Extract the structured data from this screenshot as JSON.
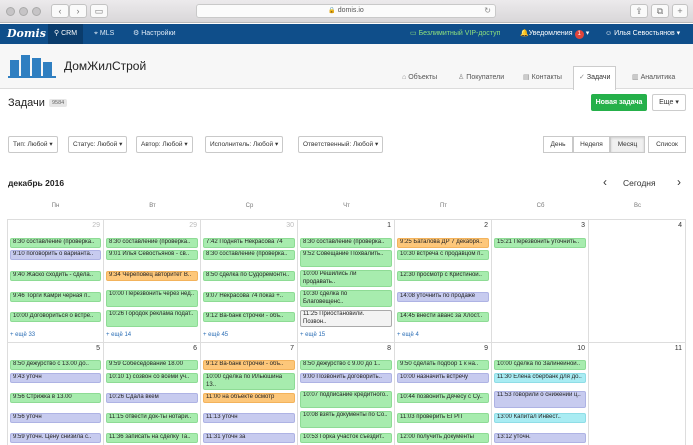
{
  "browser": {
    "url": "domis.io"
  },
  "topbar": {
    "logo": "Domis",
    "nav": [
      {
        "label": "CRM",
        "icon": "tree-icon"
      },
      {
        "label": "MLS",
        "icon": "pin-icon"
      },
      {
        "label": "Настройки",
        "icon": "gear-icon"
      }
    ],
    "vip": "Безлимитный VIP-доступ",
    "notifications_label": "Уведомления",
    "notifications_count": "1",
    "user": "Илья Севостьянов"
  },
  "company": {
    "name": "ДомЖилСтрой",
    "tabs": [
      {
        "label": "Объекты",
        "icon": "home-icon"
      },
      {
        "label": "Покупатели",
        "icon": "user-icon"
      },
      {
        "label": "Контакты",
        "icon": "contacts-icon"
      },
      {
        "label": "Задачи",
        "icon": "check-icon"
      },
      {
        "label": "Аналитика",
        "icon": "chart-icon"
      }
    ]
  },
  "page": {
    "title": "Задачи",
    "count": "9584",
    "new_task": "Новая задача",
    "more": "Еще"
  },
  "filters": [
    "Тип: Любой",
    "Статус: Любой",
    "Автор: Любой",
    "Исполнитель: Любой",
    "Ответственный: Любой"
  ],
  "views": [
    "День",
    "Неделя",
    "Месяц",
    "Список"
  ],
  "calendar": {
    "month": "декабрь 2016",
    "today": "Сегодня",
    "weekdays": [
      "Пн",
      "Вт",
      "Ср",
      "Чт",
      "Пт",
      "Сб",
      "Вс"
    ],
    "week1": {
      "days": [
        "29",
        "29",
        "30",
        "1",
        "2",
        "3",
        "4"
      ],
      "events": {
        "mon": [
          {
            "text": "8:30 составление (проверка..",
            "color": "green"
          },
          {
            "text": "9:10 поговорить о варианта..",
            "color": "blue"
          },
          {
            "text": "9:40 Жаско сходить - сдела..",
            "color": "green"
          },
          {
            "text": "9:46 Торги Камри черная п..",
            "color": "green"
          },
          {
            "text": "10:00 Договориться о встре..",
            "color": "green"
          }
        ],
        "tue": [
          {
            "text": "8:30 составление (проверка..",
            "color": "green"
          },
          {
            "text": "9:01 Илья Севостьянов - св..",
            "color": "green"
          },
          {
            "text": "9:34 Череповец авторитет В..",
            "color": "orange"
          },
          {
            "text": "10:00 Перезвонить через нед..",
            "color": "green"
          },
          {
            "text": "10:26 Городок реклама подат..",
            "color": "green"
          }
        ],
        "wed": [
          {
            "text": "7:42 Поднять Некрасова 74",
            "color": "green"
          },
          {
            "text": "8:30 составление (проверка..",
            "color": "green"
          },
          {
            "text": "8:50 сделка по Судоремонтн..",
            "color": "green"
          },
          {
            "text": "9:07 Некрасова 74 показ +..",
            "color": "green"
          },
          {
            "text": "9:12 Ва-банк строчки - объ..",
            "color": "green"
          }
        ],
        "thu": [
          {
            "text": "8:30 составление (проверка..",
            "color": "green"
          },
          {
            "text": "9:52 Совещание Похвалить..",
            "color": "green"
          },
          {
            "text": "10:00 Решились ли продавать..",
            "color": "green"
          },
          {
            "text": "10:30 сделка по Благовещенс..",
            "color": "green"
          },
          {
            "text": "11:25 Приостановили. Позвон..",
            "color": "white"
          }
        ],
        "fri": [
          {
            "text": "9:25 Баталова ДР 7 декабря..",
            "color": "orange"
          },
          {
            "text": "10:30 встреча с продавцом п..",
            "color": "green"
          },
          {
            "text": "12:30 просмотр с Кристиной..",
            "color": "green"
          },
          {
            "text": "14:08 уточнить по продаже",
            "color": "blue"
          },
          {
            "text": "14:45 внести аванс за Хлост..",
            "color": "green"
          }
        ],
        "sat": [
          {
            "text": "15:21 Перезвонить уточнить..",
            "color": "green"
          }
        ]
      },
      "more": {
        "mon": "+ ещё 33",
        "tue": "+ ещё 14",
        "wed": "+ ещё 45",
        "thu": "+ ещё 15",
        "fri": "+ ещё 4"
      }
    },
    "week2": {
      "days": [
        "5",
        "6",
        "7",
        "8",
        "9",
        "10",
        "11"
      ],
      "events": {
        "mon": [
          {
            "text": "8:50 дежурство с 13.00 до..",
            "color": "green"
          },
          {
            "text": "9:43 уточн",
            "color": "blue"
          },
          {
            "text": "9:56 Стрижка в 13.00",
            "color": "green"
          },
          {
            "text": "9:56 уточн",
            "color": "blue"
          },
          {
            "text": "9:59 уточн. Цену снизила с..",
            "color": "blue"
          }
        ],
        "tue": [
          {
            "text": "9:59 Собеседование 18.00",
            "color": "green"
          },
          {
            "text": "10:10 1) созвон со всеми уч..",
            "color": "green"
          },
          {
            "text": "10:26 Сдала вкем",
            "color": "blue"
          },
          {
            "text": "11:15 отвести док-ты нотари..",
            "color": "green"
          },
          {
            "text": "11:36 записать на сделку Та..",
            "color": "green"
          }
        ],
        "wed": [
          {
            "text": "9:12 Ва-банк строчки - объ..",
            "color": "orange"
          },
          {
            "text": "10:00 сделка по Ильюшина 13..",
            "color": "green"
          },
          {
            "text": "11:00 на объекте осмотр",
            "color": "orange"
          },
          {
            "text": "11:13 уточн",
            "color": "blue"
          },
          {
            "text": "11:31 уточн за",
            "color": "blue"
          }
        ],
        "thu": [
          {
            "text": "8:50 дежурство с 9.00 до 1..",
            "color": "green"
          },
          {
            "text": "9:00 Позвонить договорить..",
            "color": "blue"
          },
          {
            "text": "10:07 подписание кредитного..",
            "color": "green"
          },
          {
            "text": "10:08 взять документы по Со..",
            "color": "green"
          },
          {
            "text": "10:53 Горка участок съездит..",
            "color": "green"
          }
        ],
        "fri": [
          {
            "text": "9:50 сделать подбор 1 к на..",
            "color": "green"
          },
          {
            "text": "10:00 назначить встречу",
            "color": "blue"
          },
          {
            "text": "10:44 позвонить Дячесу с Су..",
            "color": "green"
          },
          {
            "text": "11:03 проверить ЕГРП",
            "color": "green"
          },
          {
            "text": "12:00 получить документы",
            "color": "green"
          }
        ],
        "sat": [
          {
            "text": "10:00 сделка по Залинейной..",
            "color": "green"
          },
          {
            "text": "11:30 Елена сбербанк для до..",
            "color": "cyan"
          },
          {
            "text": "11:53 говорили о снижении ц..",
            "color": "blue"
          },
          {
            "text": "13:00 Капитал Инвест..",
            "color": "cyan"
          },
          {
            "text": "13:12 уточн.",
            "color": "blue"
          }
        ]
      }
    }
  },
  "colors": {
    "appbar": "#0f4e8a",
    "green_event": "#a7ecae",
    "blue_event": "#c7cbef",
    "orange_event": "#fdc77a",
    "cyan_event": "#a9ecf3",
    "primary_button": "#25b04a"
  }
}
